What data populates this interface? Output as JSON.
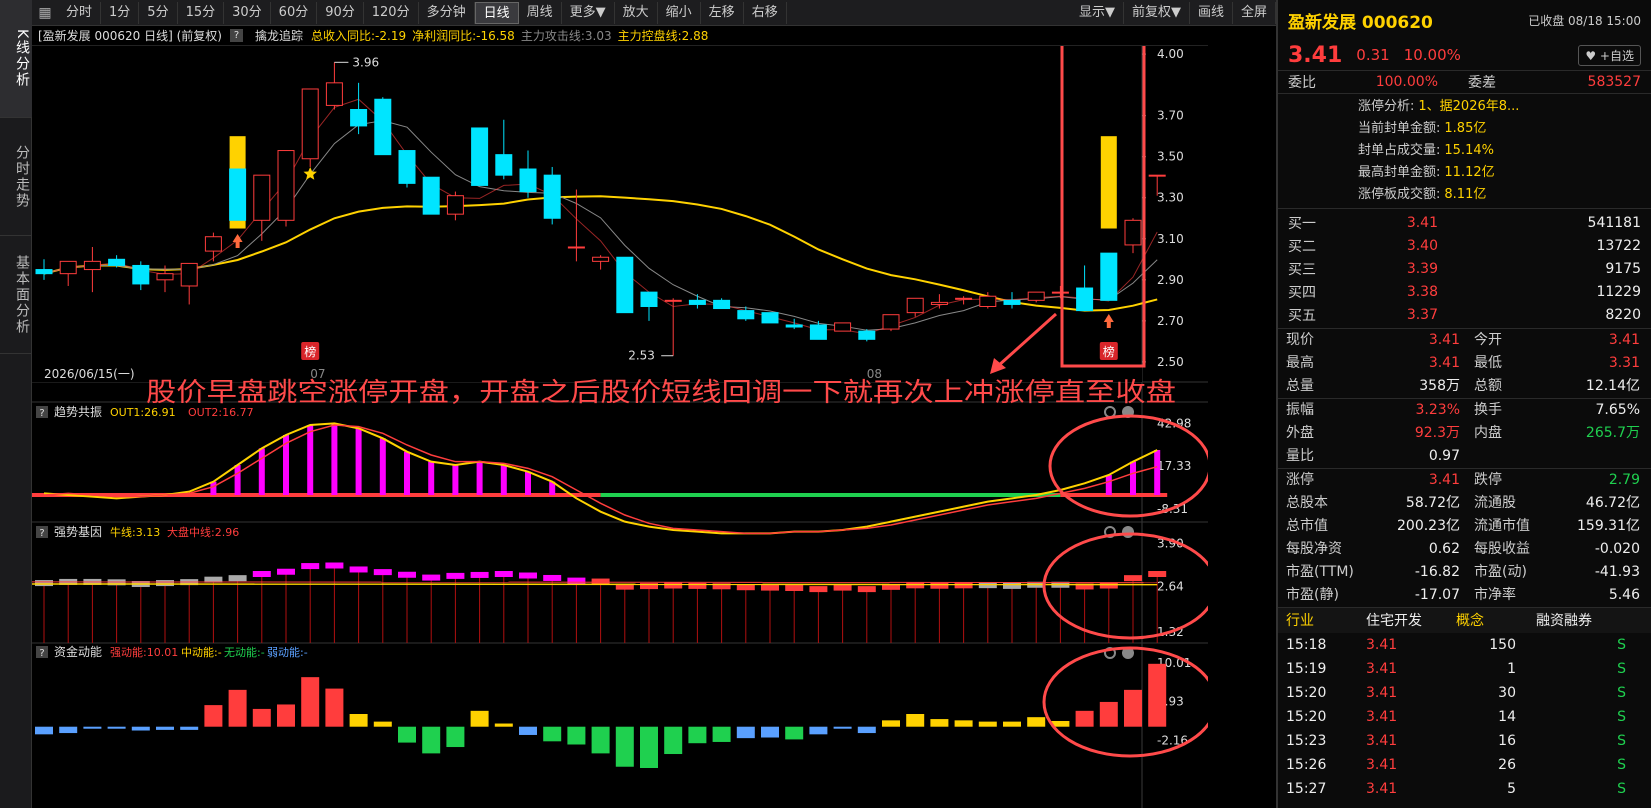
{
  "left_nav": [
    "K线分析",
    "分时走势",
    "基本面分析"
  ],
  "toolbar": {
    "periods": [
      "分时",
      "1分",
      "5分",
      "15分",
      "30分",
      "60分",
      "90分",
      "120分",
      "多分钟",
      "日线",
      "周线",
      "更多▼"
    ],
    "active_period": "日线",
    "actions": [
      "放大",
      "缩小",
      "左移",
      "右移"
    ],
    "right": [
      "显示▼",
      "前复权▼",
      "画线",
      "全屏"
    ]
  },
  "infobar": {
    "title": "[盈新发展 000620 日线] (前复权)",
    "indicator": "擒龙追踪",
    "items": [
      {
        "text": "总收入同比:-2.19",
        "color": "#ffd200"
      },
      {
        "text": "净利润同比:-16.58",
        "color": "#ffd200"
      },
      {
        "text": "主力攻击线:3.03",
        "color": "#888888"
      },
      {
        "text": "主力控盘线:2.88",
        "color": "#ffd200"
      }
    ]
  },
  "price_axis": [
    "4.00",
    "3.70",
    "3.50",
    "3.30",
    "3.10",
    "2.90",
    "2.70",
    "2.50"
  ],
  "annotations": {
    "high_label": "3.96",
    "low_label": "2.53",
    "date_label": "2026/06/15(一)",
    "month_07": "07",
    "month_08": "08",
    "bang_label": "榜",
    "overlay_text": "股价早盘跳空涨停开盘，开盘之后股价短线回调一下就再次上冲涨停直至收盘"
  },
  "panel1": {
    "name": "趋势共振",
    "items": [
      {
        "text": "OUT1:26.91",
        "color": "#ffd200"
      },
      {
        "text": "OUT2:16.77",
        "color": "#ff3d3d"
      }
    ],
    "axis": [
      "42.98",
      "17.33",
      "-8.31"
    ]
  },
  "panel2": {
    "name": "强势基因",
    "items": [
      {
        "text": "牛线:3.13",
        "color": "#ffd200"
      },
      {
        "text": "大盘中线:2.96",
        "color": "#ff3d3d"
      }
    ],
    "axis": [
      "3.90",
      "2.64",
      "1.32"
    ]
  },
  "panel3": {
    "name": "资金动能",
    "items": [
      {
        "text": "强动能:10.01",
        "color": "#ff3d3d"
      },
      {
        "text": "中动能:-",
        "color": "#ffd200"
      },
      {
        "text": "无动能:-",
        "color": "#1fd04f"
      },
      {
        "text": "弱动能:-",
        "color": "#5aa0ff"
      }
    ],
    "axis": [
      "10.01",
      "3.93",
      "-2.16"
    ]
  },
  "candles": [
    [
      2.95,
      3.0,
      2.9,
      2.93
    ],
    [
      2.93,
      2.99,
      2.87,
      2.99
    ],
    [
      2.95,
      3.06,
      2.84,
      2.99
    ],
    [
      3.0,
      3.02,
      2.96,
      2.97
    ],
    [
      2.97,
      2.99,
      2.85,
      2.88
    ],
    [
      2.9,
      2.97,
      2.84,
      2.93
    ],
    [
      2.87,
      2.98,
      2.78,
      2.98
    ],
    [
      3.04,
      3.13,
      2.99,
      3.11
    ],
    [
      3.44,
      3.44,
      3.19,
      3.19
    ],
    [
      3.19,
      3.39,
      3.09,
      3.41
    ],
    [
      3.19,
      3.53,
      3.16,
      3.53
    ],
    [
      3.49,
      3.83,
      3.45,
      3.83
    ],
    [
      3.75,
      3.96,
      3.73,
      3.86
    ],
    [
      3.73,
      3.86,
      3.61,
      3.65
    ],
    [
      3.78,
      3.79,
      3.51,
      3.51
    ],
    [
      3.53,
      3.53,
      3.35,
      3.37
    ],
    [
      3.4,
      3.4,
      3.22,
      3.22
    ],
    [
      3.22,
      3.33,
      3.19,
      3.31
    ],
    [
      3.64,
      3.64,
      3.36,
      3.36
    ],
    [
      3.51,
      3.68,
      3.39,
      3.41
    ],
    [
      3.44,
      3.53,
      3.3,
      3.33
    ],
    [
      3.41,
      3.45,
      3.17,
      3.2
    ],
    [
      3.06,
      3.34,
      2.99,
      3.06
    ],
    [
      2.99,
      3.02,
      2.95,
      3.01
    ],
    [
      3.01,
      3.01,
      2.74,
      2.74
    ],
    [
      2.84,
      2.84,
      2.7,
      2.77
    ],
    [
      2.8,
      2.81,
      2.53,
      2.8
    ],
    [
      2.8,
      2.83,
      2.76,
      2.78
    ],
    [
      2.8,
      2.81,
      2.76,
      2.76
    ],
    [
      2.75,
      2.77,
      2.7,
      2.71
    ],
    [
      2.74,
      2.74,
      2.69,
      2.69
    ],
    [
      2.68,
      2.71,
      2.66,
      2.67
    ],
    [
      2.68,
      2.7,
      2.61,
      2.61
    ],
    [
      2.65,
      2.69,
      2.65,
      2.69
    ],
    [
      2.65,
      2.66,
      2.6,
      2.61
    ],
    [
      2.66,
      2.73,
      2.65,
      2.73
    ],
    [
      2.74,
      2.81,
      2.72,
      2.81
    ],
    [
      2.78,
      2.83,
      2.76,
      2.79
    ],
    [
      2.81,
      2.82,
      2.78,
      2.81
    ],
    [
      2.77,
      2.84,
      2.76,
      2.82
    ],
    [
      2.8,
      2.84,
      2.76,
      2.78
    ],
    [
      2.8,
      2.84,
      2.79,
      2.84
    ],
    [
      2.84,
      2.87,
      2.81,
      2.84
    ],
    [
      2.86,
      2.97,
      2.78,
      2.75
    ],
    [
      3.03,
      3.03,
      2.8,
      2.8
    ],
    [
      3.07,
      3.2,
      3.03,
      3.19
    ],
    [
      3.41,
      3.41,
      3.31,
      3.41
    ]
  ],
  "quote": {
    "name": "盈新发展 000620",
    "status": "已收盘 08/18 15:00",
    "price": "3.41",
    "change": "0.31",
    "pct": "10.00%",
    "fav_label": "♥ +自选",
    "weibi_label": "委比",
    "weibi": "100.00%",
    "weicha_label": "委差",
    "weicha": "583527",
    "zt_lines": [
      {
        "k": "涨停分析:",
        "v": "1、据2026年8..."
      },
      {
        "k": "当前封单金额:",
        "v": "1.85亿"
      },
      {
        "k": "封单占成交量:",
        "v": "15.14%"
      },
      {
        "k": "最高封单金额:",
        "v": "11.12亿"
      },
      {
        "k": "涨停板成交额:",
        "v": "8.11亿"
      }
    ],
    "bids": [
      {
        "k": "买一",
        "p": "3.41",
        "v": "541181"
      },
      {
        "k": "买二",
        "p": "3.40",
        "v": "13722"
      },
      {
        "k": "买三",
        "p": "3.39",
        "v": "9175"
      },
      {
        "k": "买四",
        "p": "3.38",
        "v": "11229"
      },
      {
        "k": "买五",
        "p": "3.37",
        "v": "8220"
      }
    ],
    "stats1": [
      [
        "现价",
        "3.41",
        "今开",
        "3.41"
      ],
      [
        "最高",
        "3.41",
        "最低",
        "3.31"
      ],
      [
        "总量",
        "358万",
        "总额",
        "12.14亿"
      ]
    ],
    "stats2": [
      [
        "振幅",
        "3.23%",
        "换手",
        "7.65%"
      ],
      [
        "外盘",
        "92.3万",
        "内盘",
        "265.7万"
      ],
      [
        "量比",
        "0.97",
        "",
        ""
      ]
    ],
    "stats3": [
      [
        "涨停",
        "3.41",
        "跌停",
        "2.79"
      ],
      [
        "总股本",
        "58.72亿",
        "流通股",
        "46.72亿"
      ],
      [
        "总市值",
        "200.23亿",
        "流通市值",
        "159.31亿"
      ],
      [
        "每股净资",
        "0.62",
        "每股收益",
        "-0.020"
      ],
      [
        "市盈(TTM)",
        "-16.82",
        "市盈(动)",
        "-41.93"
      ],
      [
        "市盈(静)",
        "-17.07",
        "市净率",
        "5.46"
      ]
    ],
    "tabs": [
      "行业",
      "住宅开发",
      "概念",
      "融资融券"
    ],
    "trades": [
      [
        "15:18",
        "3.41",
        "150",
        "S"
      ],
      [
        "15:19",
        "3.41",
        "1",
        "S"
      ],
      [
        "15:20",
        "3.41",
        "30",
        "S"
      ],
      [
        "15:20",
        "3.41",
        "14",
        "S"
      ],
      [
        "15:23",
        "3.41",
        "16",
        "S"
      ],
      [
        "15:26",
        "3.41",
        "26",
        "S"
      ],
      [
        "15:27",
        "3.41",
        "5",
        "S"
      ]
    ]
  },
  "colors": {
    "up": "#ff3d3d",
    "down": "#00e5ff",
    "ma_yellow": "#ffd200",
    "ma_gray": "#888888",
    "annotation": "#ff4a4a"
  }
}
